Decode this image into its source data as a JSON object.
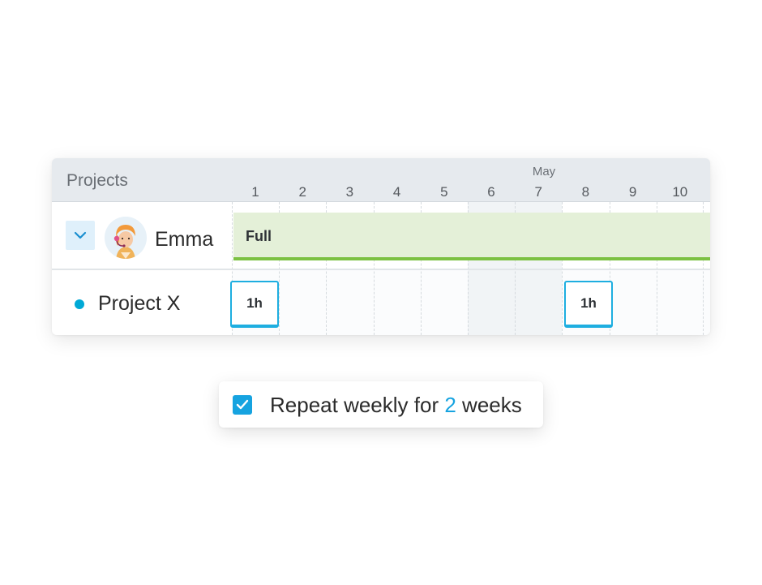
{
  "header": {
    "title": "Projects",
    "month": "May",
    "days": [
      "1",
      "2",
      "3",
      "4",
      "5",
      "6",
      "7",
      "8",
      "9",
      "10"
    ],
    "weekend_days": [
      "6",
      "7"
    ]
  },
  "person": {
    "name": "Emma",
    "expand_icon": "chevron-down-icon",
    "avatar_icon": "avatar-illustration"
  },
  "availability_bar": {
    "label": "Full",
    "color": "#7cc142",
    "fill": "#e4f0d8"
  },
  "project": {
    "name": "Project X",
    "dot_color": "#00a9d6",
    "blocks": [
      {
        "day": "1",
        "label": "1h"
      },
      {
        "day": "8",
        "label": "1h"
      }
    ]
  },
  "repeat": {
    "checked": true,
    "check_icon": "checkmark-icon",
    "text_before": "Repeat weekly for",
    "count": "2",
    "text_after": "weeks",
    "accent": "#16a3e0"
  }
}
